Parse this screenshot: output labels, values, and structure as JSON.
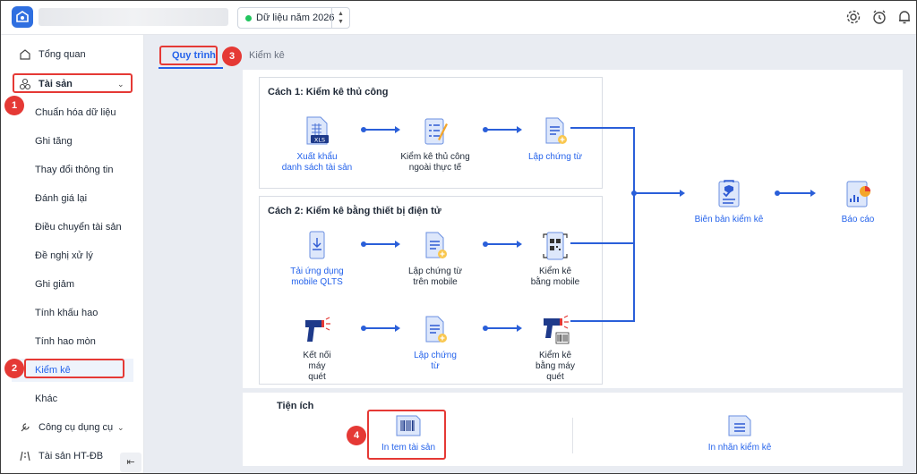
{
  "header": {
    "year_select": "Dữ liệu năm 2026",
    "icons": [
      "logo-icon",
      "settings-icon",
      "alarm-icon",
      "bell-icon"
    ]
  },
  "sidebar": {
    "items": [
      {
        "label": "Tổng quan",
        "icon": "home-icon"
      },
      {
        "label": "Tài sản",
        "icon": "assets-icon"
      },
      {
        "label": "Chuẩn hóa dữ liệu"
      },
      {
        "label": "Ghi tăng"
      },
      {
        "label": "Thay đổi thông tin"
      },
      {
        "label": "Đánh giá lại"
      },
      {
        "label": "Điều chuyển tài sản"
      },
      {
        "label": "Đề nghị xử lý"
      },
      {
        "label": "Ghi giảm"
      },
      {
        "label": "Tính khấu hao"
      },
      {
        "label": "Tính hao mòn"
      },
      {
        "label": "Kiểm kê"
      },
      {
        "label": "Khác"
      },
      {
        "label": "Công cụ dụng cụ",
        "icon": "tools-icon"
      },
      {
        "label": "Tài sản HT-ĐB",
        "icon": "road-icon"
      }
    ],
    "collapse_icon": "collapse-sidebar-icon"
  },
  "tabs": [
    {
      "label": "Quy trình"
    },
    {
      "label": "Kiểm kê"
    }
  ],
  "callouts": [
    "1",
    "2",
    "3",
    "4"
  ],
  "method1": {
    "title": "Cách 1: Kiểm kê thủ công",
    "steps": [
      {
        "line1": "Xuất khẩu",
        "line2": "danh sách tài sản",
        "icon": "excel-export-icon"
      },
      {
        "line1": "Kiểm kê thủ công",
        "line2": "ngoài thực tế",
        "icon": "checklist-icon"
      },
      {
        "line1": "Lập chứng từ",
        "line2": "",
        "icon": "document-add-icon"
      }
    ]
  },
  "method2": {
    "title": "Cách 2: Kiểm kê bằng thiết bị điện tử",
    "row1": [
      {
        "line1": "Tải ứng dụng",
        "line2": "mobile QLTS",
        "icon": "mobile-download-icon"
      },
      {
        "line1": "Lập chứng từ",
        "line2": "trên mobile",
        "icon": "document-add-icon"
      },
      {
        "line1": "Kiểm kê",
        "line2": "bằng mobile",
        "icon": "qr-scan-icon"
      }
    ],
    "row2": [
      {
        "line1": "Kết nối",
        "line2": "máy",
        "line3": "quét",
        "icon": "barcode-scanner-icon"
      },
      {
        "line1": "Lập chứng",
        "line2": "từ",
        "icon": "document-add-icon"
      },
      {
        "line1": "Kiểm kê",
        "line2": "bằng máy",
        "line3": "quét",
        "icon": "scanner-barcode-icon"
      }
    ]
  },
  "outcomes": [
    {
      "label": "Biên bản kiểm kê",
      "icon": "inventory-report-icon"
    },
    {
      "label": "Báo cáo",
      "icon": "report-chart-icon"
    }
  ],
  "utilities": {
    "title": "Tiện ích",
    "items": [
      {
        "label": "In tem tài sản",
        "icon": "barcode-label-icon"
      },
      {
        "label": "In nhãn kiểm kê",
        "icon": "label-document-icon"
      }
    ]
  }
}
